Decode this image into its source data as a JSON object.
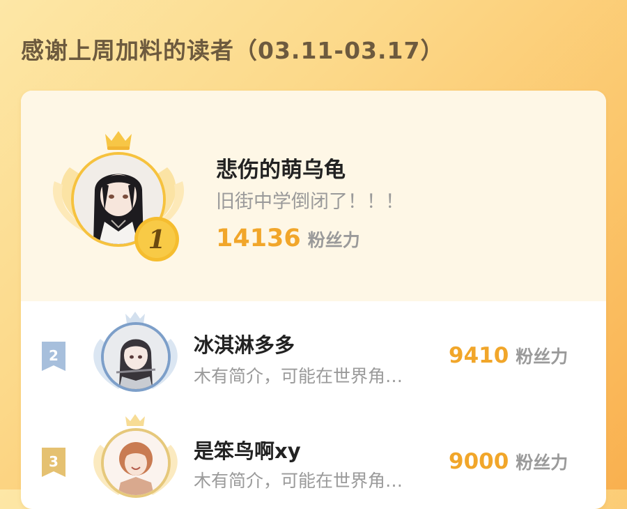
{
  "header": {
    "title": "感谢上周加料的读者（03.11-03.17）"
  },
  "winner": {
    "rank": "1",
    "name": "悲伤的萌乌龟",
    "bio": "旧街中学倒闭了！！！",
    "score": "14136",
    "score_unit": "粉丝力"
  },
  "rows": [
    {
      "rank": "2",
      "name": "冰淇淋多多",
      "bio": "木有简介，可能在世界角…",
      "score": "9410",
      "score_unit": "粉丝力"
    },
    {
      "rank": "3",
      "name": "是笨鸟啊xy",
      "bio": "木有简介，可能在世界角…",
      "score": "9000",
      "score_unit": "粉丝力"
    }
  ],
  "colors": {
    "accent": "#f1a62a",
    "gold": "#f6c23e",
    "silver": "#a7bfdc",
    "bronze": "#e5c171",
    "title": "#6d5a3e"
  }
}
